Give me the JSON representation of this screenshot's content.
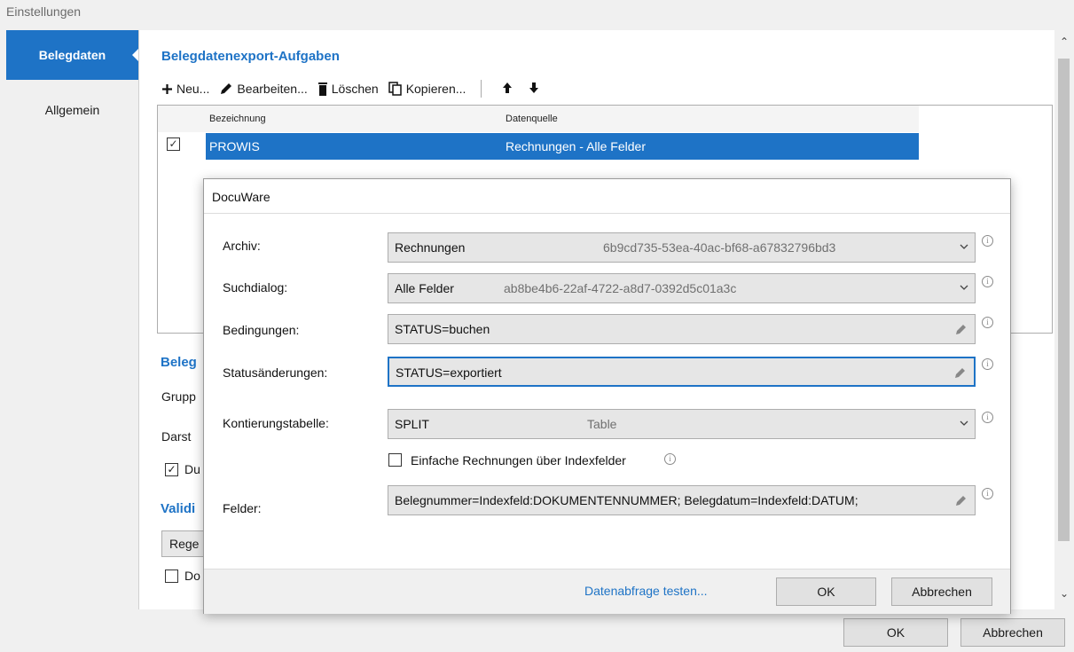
{
  "window": {
    "title": "Einstellungen"
  },
  "nav": {
    "items": [
      {
        "label": "Belegdaten"
      },
      {
        "label": "Allgemein"
      }
    ]
  },
  "main": {
    "section_title": "Belegdatenexport-Aufgaben",
    "toolbar": {
      "new_label": "Neu...",
      "edit_label": "Bearbeiten...",
      "delete_label": "Löschen",
      "copy_label": "Kopieren...",
      "up_icon": "arrow-up-icon",
      "down_icon": "arrow-down-icon"
    },
    "table": {
      "columns": [
        "Bezeichnung",
        "Datenquelle"
      ],
      "rows": [
        {
          "checked": true,
          "name": "PROWIS",
          "source": "Rechnungen - Alle Felder"
        }
      ]
    },
    "partial": {
      "section2_title": "Beleg",
      "label_grupp": "Grupp",
      "label_darst": "Darst",
      "check_du_label": "Du",
      "section3_title": "Validi",
      "button_rege": "Rege",
      "check_do_label": "Do"
    }
  },
  "footer": {
    "ok_label": "OK",
    "cancel_label": "Abbrechen"
  },
  "dialog": {
    "title": "DocuWare",
    "fields": {
      "archiv": {
        "label": "Archiv:",
        "value": "Rechnungen",
        "id": "6b9cd735-53ea-40ac-bf68-a67832796bd3"
      },
      "suchdialog": {
        "label": "Suchdialog:",
        "value": "Alle Felder",
        "id": "ab8be4b6-22af-4722-a8d7-0392d5c01a3c"
      },
      "bedingungen": {
        "label": "Bedingungen:",
        "value": "STATUS=buchen"
      },
      "statusaenderungen": {
        "label": "Statusänderungen:",
        "value": "STATUS=exportiert"
      },
      "kontierungstabelle": {
        "label": "Kontierungstabelle:",
        "value": "SPLIT",
        "type": "Table"
      },
      "felder": {
        "label": "Felder:",
        "value": "Belegnummer=Indexfeld:DOKUMENTENNUMMER; Belegdatum=Indexfeld:DATUM;"
      }
    },
    "simple_invoices": {
      "label": "Einfache Rechnungen über Indexfelder",
      "checked": false
    },
    "test_link": "Datenabfrage testen...",
    "ok_label": "OK",
    "cancel_label": "Abbrechen",
    "info_glyph": "i"
  },
  "colors": {
    "accent": "#1e73c6",
    "selection": "#1e73c6"
  }
}
